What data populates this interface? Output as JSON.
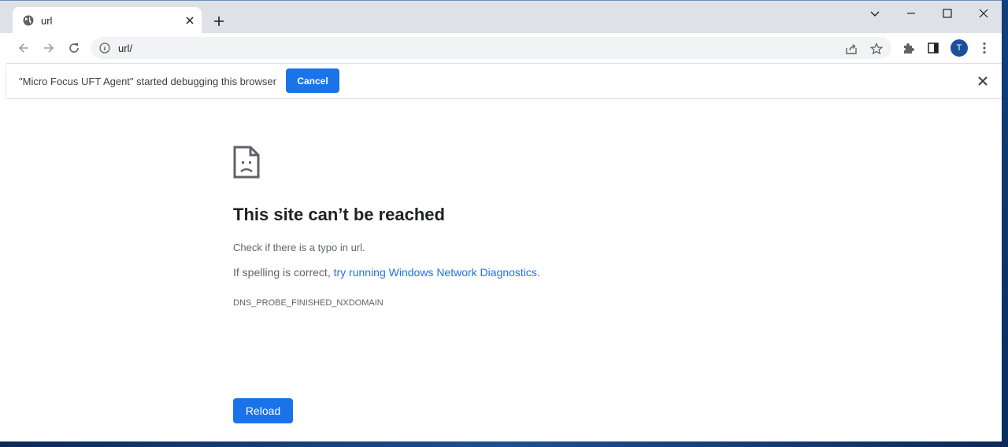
{
  "tab": {
    "title": "url",
    "icon": "globe-icon"
  },
  "toolbar": {
    "url": "url/"
  },
  "profile": {
    "initial": "T"
  },
  "infobar": {
    "message": "\"Micro Focus UFT Agent\" started debugging this browser",
    "cancel_label": "Cancel"
  },
  "error": {
    "title": "This site can’t be reached",
    "line1": "Check if there is a typo in url.",
    "line2_prefix": "If spelling is correct, ",
    "line2_link": "try running Windows Network Diagnostics",
    "line2_suffix": ".",
    "code": "DNS_PROBE_FINISHED_NXDOMAIN",
    "reload_label": "Reload"
  },
  "colors": {
    "accent": "#1a73e8",
    "tabstrip_bg": "#dee1e6",
    "omnibox_bg": "#f1f3f4",
    "avatar_bg": "#1a4f9c"
  }
}
